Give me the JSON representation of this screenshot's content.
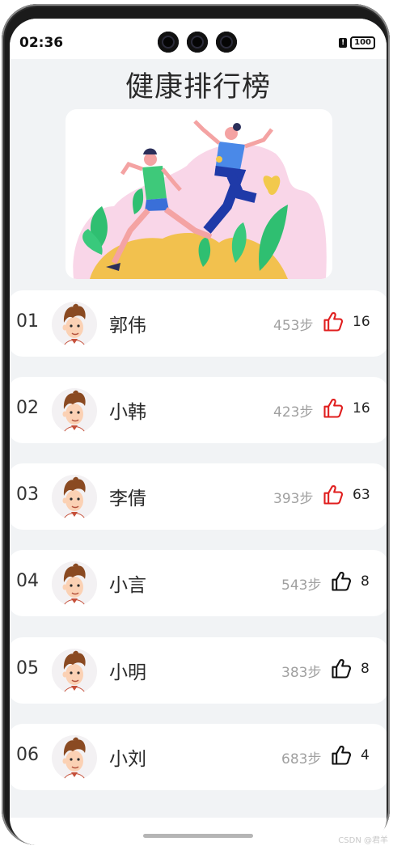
{
  "status_bar": {
    "time": "02:36",
    "battery": "100",
    "alert_glyph": "!"
  },
  "page": {
    "title": "健康排行榜"
  },
  "banner": {
    "illustration": "running-people-illustration"
  },
  "ranking": [
    {
      "rank": "01",
      "name": "郭伟",
      "steps": "453步",
      "likes": "16",
      "liked": true
    },
    {
      "rank": "02",
      "name": "小韩",
      "steps": "423步",
      "likes": "16",
      "liked": true
    },
    {
      "rank": "03",
      "name": "李倩",
      "steps": "393步",
      "likes": "63",
      "liked": true
    },
    {
      "rank": "04",
      "name": "小言",
      "steps": "543步",
      "likes": "8",
      "liked": false
    },
    {
      "rank": "05",
      "name": "小明",
      "steps": "383步",
      "likes": "8",
      "liked": false
    },
    {
      "rank": "06",
      "name": "小刘",
      "steps": "683步",
      "likes": "4",
      "liked": false
    }
  ],
  "watermark": "CSDN @君羊",
  "colors": {
    "liked": "#e01e1e",
    "not_liked": "#111111",
    "background": "#f1f3f5",
    "card": "#ffffff"
  }
}
